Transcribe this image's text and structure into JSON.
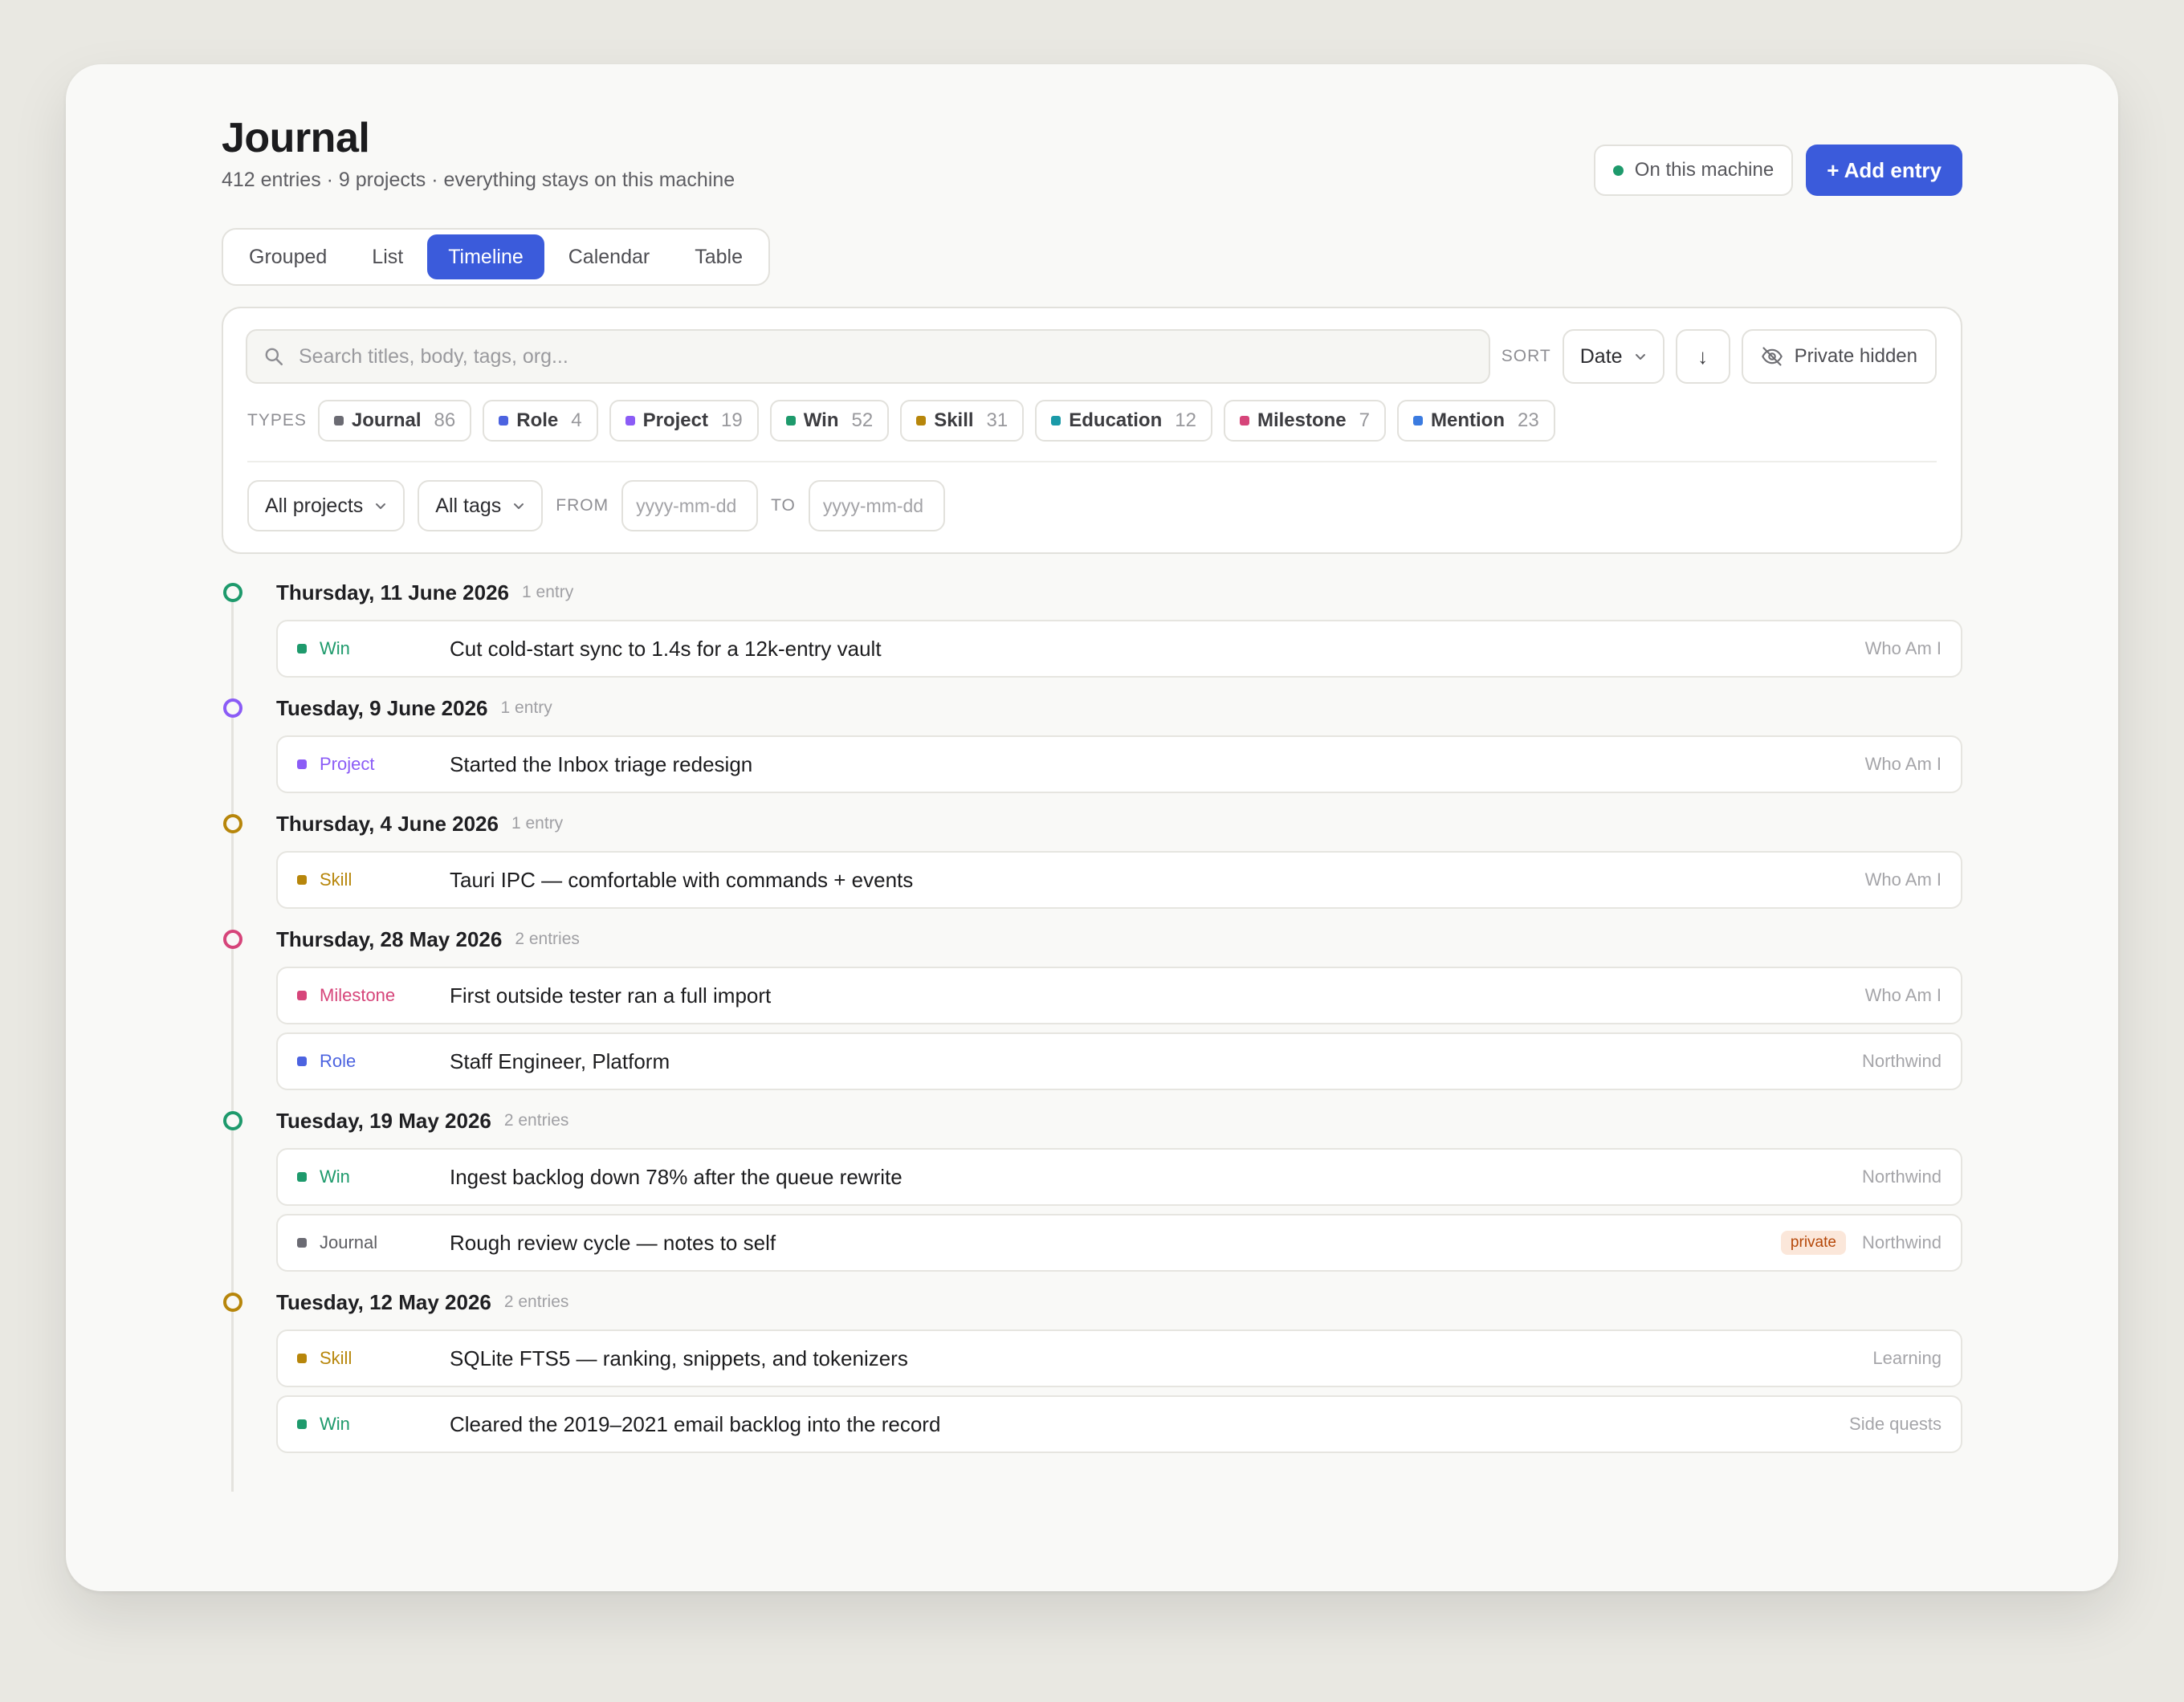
{
  "header": {
    "title": "Journal",
    "subtitle": "412 entries · 9 projects · everything stays on this machine",
    "machine_badge": "On this machine",
    "add_button": "+ Add entry"
  },
  "tabs": [
    {
      "label": "Grouped"
    },
    {
      "label": "List"
    },
    {
      "label": "Timeline",
      "active": true
    },
    {
      "label": "Calendar"
    },
    {
      "label": "Table"
    }
  ],
  "filters": {
    "search_placeholder": "Search titles, body, tags, org...",
    "sort_label": "SORT",
    "sort_value": "Date",
    "sort_direction_glyph": "↓",
    "private_label": "Private hidden",
    "types_label": "TYPES",
    "types": [
      {
        "name": "Journal",
        "count": "86",
        "color": "#6b6b73"
      },
      {
        "name": "Role",
        "count": "4",
        "color": "#4c63e0"
      },
      {
        "name": "Project",
        "count": "19",
        "color": "#8b5cf6"
      },
      {
        "name": "Win",
        "count": "52",
        "color": "#1e9a6c"
      },
      {
        "name": "Skill",
        "count": "31",
        "color": "#b7860b"
      },
      {
        "name": "Education",
        "count": "12",
        "color": "#1a9aa8"
      },
      {
        "name": "Milestone",
        "count": "7",
        "color": "#d6457a"
      },
      {
        "name": "Mention",
        "count": "23",
        "color": "#3b7be0"
      }
    ],
    "projects_dropdown": "All projects",
    "tags_dropdown": "All tags",
    "from_label": "FROM",
    "to_label": "TO",
    "date_placeholder": "yyyy-mm-dd"
  },
  "timeline": [
    {
      "date": "Thursday, 11 June 2026",
      "count": "1 entry",
      "ring_color": "#1e9a6c",
      "entries": [
        {
          "type": "Win",
          "color": "#1e9a6c",
          "title": "Cut cold-start sync to 1.4s for a 12k-entry vault",
          "project": "Who Am I"
        }
      ]
    },
    {
      "date": "Tuesday, 9 June 2026",
      "count": "1 entry",
      "ring_color": "#8b5cf6",
      "entries": [
        {
          "type": "Project",
          "color": "#8b5cf6",
          "title": "Started the Inbox triage redesign",
          "project": "Who Am I"
        }
      ]
    },
    {
      "date": "Thursday, 4 June 2026",
      "count": "1 entry",
      "ring_color": "#b7860b",
      "entries": [
        {
          "type": "Skill",
          "color": "#b7860b",
          "title": "Tauri IPC — comfortable with commands + events",
          "project": "Who Am I"
        }
      ]
    },
    {
      "date": "Thursday, 28 May 2026",
      "count": "2 entries",
      "ring_color": "#d6457a",
      "entries": [
        {
          "type": "Milestone",
          "color": "#d6457a",
          "title": "First outside tester ran a full import",
          "project": "Who Am I"
        },
        {
          "type": "Role",
          "color": "#4c63e0",
          "title": "Staff Engineer, Platform",
          "project": "Northwind"
        }
      ]
    },
    {
      "date": "Tuesday, 19 May 2026",
      "count": "2 entries",
      "ring_color": "#1e9a6c",
      "entries": [
        {
          "type": "Win",
          "color": "#1e9a6c",
          "title": "Ingest backlog down 78% after the queue rewrite",
          "project": "Northwind"
        },
        {
          "type": "Journal",
          "color": "#6b6b73",
          "title": "Rough review cycle — notes to self",
          "project": "Northwind",
          "private": "private"
        }
      ]
    },
    {
      "date": "Tuesday, 12 May 2026",
      "count": "2 entries",
      "ring_color": "#b7860b",
      "entries": [
        {
          "type": "Skill",
          "color": "#b7860b",
          "title": "SQLite FTS5 — ranking, snippets, and tokenizers",
          "project": "Learning"
        },
        {
          "type": "Win",
          "color": "#1e9a6c",
          "title": "Cleared the 2019–2021 email backlog into the record",
          "project": "Side quests"
        }
      ]
    }
  ]
}
